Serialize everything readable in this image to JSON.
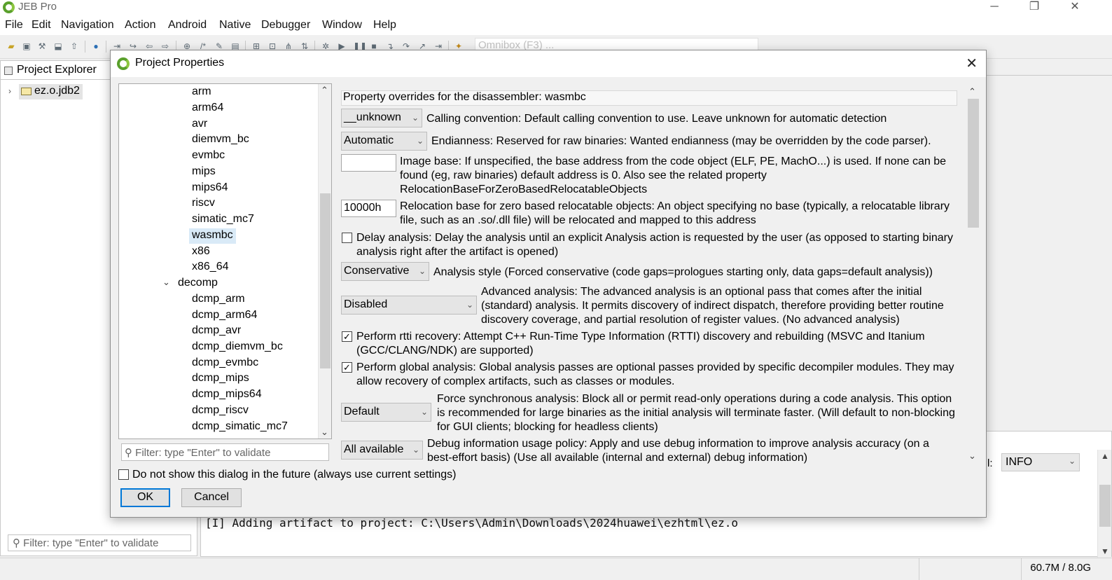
{
  "app": {
    "title": "JEB Pro"
  },
  "window_controls": {
    "minimize": "─",
    "restore": "❐",
    "close": "✕"
  },
  "menu": [
    "File",
    "Edit",
    "Navigation",
    "Action",
    "Android",
    "Native",
    "Debugger",
    "Window",
    "Help"
  ],
  "toolbar": {
    "omnibox_placeholder": "Omnibox (F3) ..."
  },
  "explorer": {
    "tab_label": "Project Explorer",
    "node_label": "ez.o.jdb2",
    "filter_placeholder": "Filter: type \"Enter\" to validate"
  },
  "log": {
    "line": "[I] Adding artifact to project: C:\\Users\\Admin\\Downloads\\2024huawei\\ezhtml\\ez.o",
    "level_label": "l:",
    "level_value": "INFO"
  },
  "status": {
    "memory": "60.7M / 8.0G"
  },
  "dialog": {
    "title": "Project Properties",
    "tree": {
      "items": [
        {
          "label": "arm",
          "level": 2
        },
        {
          "label": "arm64",
          "level": 2
        },
        {
          "label": "avr",
          "level": 2
        },
        {
          "label": "diemvm_bc",
          "level": 2
        },
        {
          "label": "evmbc",
          "level": 2
        },
        {
          "label": "mips",
          "level": 2
        },
        {
          "label": "mips64",
          "level": 2
        },
        {
          "label": "riscv",
          "level": 2
        },
        {
          "label": "simatic_mc7",
          "level": 2
        },
        {
          "label": "wasmbc",
          "level": 2,
          "selected": true
        },
        {
          "label": "x86",
          "level": 2
        },
        {
          "label": "x86_64",
          "level": 2
        },
        {
          "label": "decomp",
          "level": 1,
          "expanded": true
        },
        {
          "label": "dcmp_arm",
          "level": 2
        },
        {
          "label": "dcmp_arm64",
          "level": 2
        },
        {
          "label": "dcmp_avr",
          "level": 2
        },
        {
          "label": "dcmp_diemvm_bc",
          "level": 2
        },
        {
          "label": "dcmp_evmbc",
          "level": 2
        },
        {
          "label": "dcmp_mips",
          "level": 2
        },
        {
          "label": "dcmp_mips64",
          "level": 2
        },
        {
          "label": "dcmp_riscv",
          "level": 2
        },
        {
          "label": "dcmp_simatic_mc7",
          "level": 2
        }
      ],
      "filter_placeholder": "Filter: type \"Enter\" to validate"
    },
    "properties": {
      "header": "Property overrides for the disassembler: wasmbc",
      "calling_convention": {
        "value": "__unknown",
        "desc": "Calling convention: Default calling convention to use. Leave unknown for automatic detection"
      },
      "endianness": {
        "value": "Automatic",
        "desc": "Endianness: Reserved for raw binaries: Wanted endianness (may be overridden by the code parser)."
      },
      "image_base": {
        "value": "",
        "desc": "Image base: If unspecified, the base address from the code object (ELF, PE, MachO...) is used. If none can be found (eg, raw binaries) default address is 0. Also see the related property RelocationBaseForZeroBasedRelocatableObjects"
      },
      "relocation_base": {
        "value": "10000h",
        "desc": "Relocation base for zero based relocatable objects: An object specifying no base (typically, a relocatable library file, such as an .so/.dll file) will be relocated and mapped to this address"
      },
      "delay_analysis": {
        "checked": false,
        "desc": "Delay analysis: Delay the analysis until an explicit Analysis action is requested by the user (as opposed to starting binary analysis right after the artifact is opened)"
      },
      "analysis_style": {
        "value": "Conservative",
        "desc": "Analysis style (Forced conservative (code gaps=prologues starting only, data gaps=default analysis))"
      },
      "advanced_analysis": {
        "value": "Disabled",
        "desc": "Advanced analysis: The advanced analysis is an optional pass that comes after the initial (standard) analysis. It permits discovery of indirect dispatch, therefore providing better routine discovery coverage, and partial resolution of register values. (No advanced analysis)"
      },
      "rtti_recovery": {
        "checked": true,
        "desc": "Perform rtti recovery: Attempt C++ Run-Time Type Information (RTTI) discovery and rebuilding (MSVC and Itanium (GCC/CLANG/NDK) are supported)"
      },
      "global_analysis": {
        "checked": true,
        "desc": "Perform global analysis: Global analysis passes are optional passes provided by specific decompiler modules. They may allow recovery of complex artifacts, such as classes or modules."
      },
      "force_sync": {
        "value": "Default",
        "desc": "Force synchronous analysis: Block all or permit read-only operations during a code analysis. This option is recommended for large binaries as the initial analysis will terminate faster. (Will default to non-blocking for GUI clients; blocking for headless clients)"
      },
      "debug_info": {
        "value": "All available",
        "desc": "Debug information usage policy: Apply and use debug information to improve analysis accuracy (on a best-effort basis) (Use all available (internal and external) debug information)"
      }
    },
    "dont_show_label": "Do not show this dialog in the future (always use current settings)",
    "ok_label": "OK",
    "cancel_label": "Cancel"
  },
  "colors": {
    "accent": "#0078d7",
    "selection": "#d9eaf7",
    "logo": "#5aa02c"
  }
}
